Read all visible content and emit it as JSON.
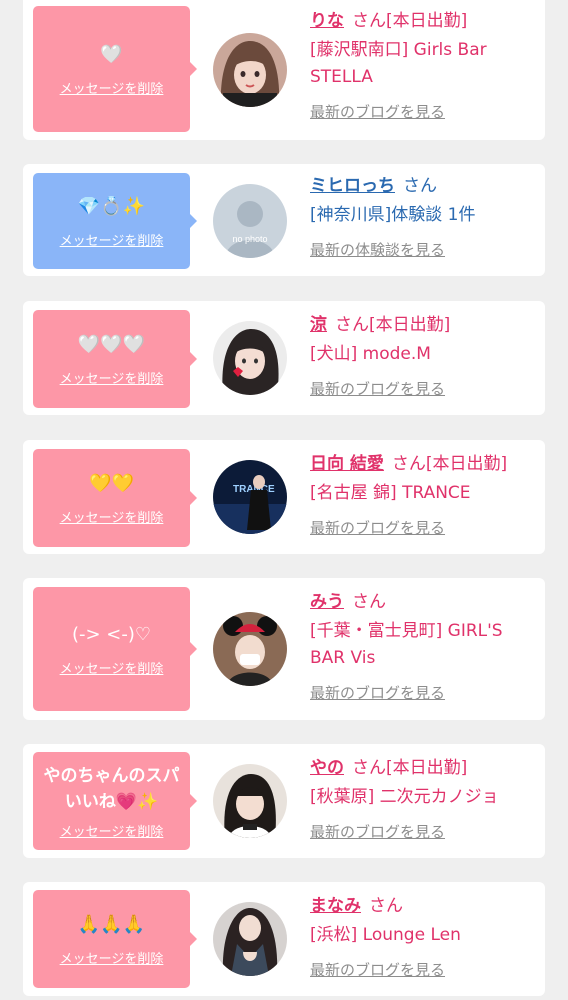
{
  "delete_label": "メッセージを削除",
  "san_label": "さん",
  "colors": {
    "pink": "#fd97a7",
    "blue": "#8ab5f8",
    "name_pink": "#e0326a",
    "name_blue": "#2a69b0"
  },
  "items": [
    {
      "message": "🤍",
      "name": "りな",
      "status": "[本日出勤]",
      "shop": "[藤沢駅南口] Girls Bar STELLA",
      "link": "最新のブログを見る"
    },
    {
      "message": "💎💍✨",
      "name": "ミヒロっち",
      "status": "",
      "shop": "[神奈川県]体験談 1件",
      "link": "最新の体験談を見る",
      "avatar_text": "no photo"
    },
    {
      "message": "🤍🤍🤍",
      "name": "涼",
      "status": "[本日出勤]",
      "shop": "[犬山] mode.M",
      "link": "最新のブログを見る"
    },
    {
      "message": "💛💛",
      "name": "日向 結愛",
      "status": "[本日出勤]",
      "shop": "[名古屋 錦] TRANCE",
      "link": "最新のブログを見る",
      "avatar_text": "TRANCE"
    },
    {
      "message": "(-> <-)♡",
      "name": "みう",
      "status": "",
      "shop": "[千葉・富士見町] GIRL'S BAR Vis",
      "link": "最新のブログを見る"
    },
    {
      "message": "やのちゃんのスパいいね💗✨",
      "name": "やの",
      "status": "[本日出勤]",
      "shop": "[秋葉原] 二次元カノジョ",
      "link": "最新のブログを見る"
    },
    {
      "message": "🙏🙏🙏",
      "name": "まなみ",
      "status": "",
      "shop": "[浜松] Lounge Len",
      "link": "最新のブログを見る"
    }
  ]
}
